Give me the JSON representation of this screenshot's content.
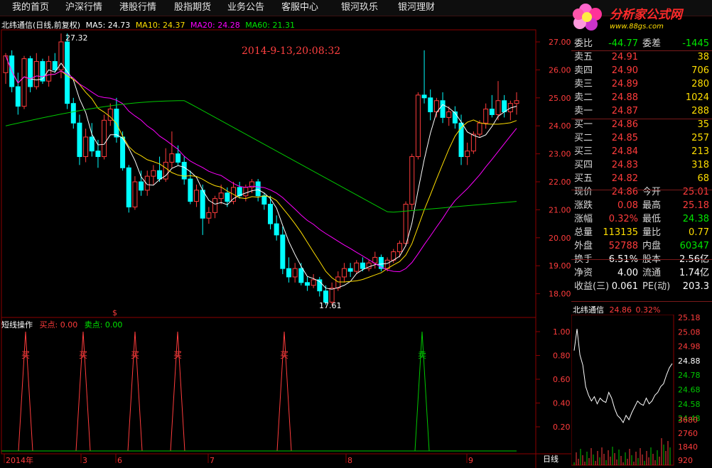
{
  "menu": [
    {
      "label": "我的首页"
    },
    {
      "label": "沪深行情"
    },
    {
      "label": "港股行情"
    },
    {
      "label": "股指期货"
    },
    {
      "label": "业务公告"
    },
    {
      "label": "客服中心"
    },
    {
      "label": "银河玖乐"
    },
    {
      "label": "银河理财"
    }
  ],
  "logo": {
    "text": "分析家公式网",
    "url": "www.88gs.com",
    "icon": "flower-logo-icon"
  },
  "header": {
    "title": "北纬通信(日线,前复权)",
    "ma5": "MA5: 24.73",
    "ma10": "MA10: 24.37",
    "ma20": "MA20: 24.28",
    "ma60": "MA60: 21.31"
  },
  "timestamp": "2014-9-13,20:08:32",
  "annotations": {
    "high": "27.32",
    "low": "17.61",
    "dollar": "$"
  },
  "price_axis": [
    "27.00",
    "26.00",
    "25.00",
    "24.00",
    "23.00",
    "22.00",
    "21.00",
    "20.00",
    "19.00",
    "18.00"
  ],
  "sub_header": {
    "name": "短线操作",
    "buy": "买点: 0.00",
    "sell": "卖点: 0.00"
  },
  "sub_axis": [
    "1.00",
    "0.80",
    "0.60",
    "0.40",
    "0.20"
  ],
  "signals": {
    "buy": "买",
    "sell": "卖"
  },
  "date_axis": [
    "2014年",
    "3",
    "6",
    "7",
    "8",
    "9"
  ],
  "bottom_tab": "日线",
  "quote": {
    "ratio_label": "委比",
    "ratio": "-44.77",
    "diff_label": "委差",
    "diff": "-1445",
    "asks": [
      {
        "label": "卖五",
        "price": "24.91",
        "vol": "38"
      },
      {
        "label": "卖四",
        "price": "24.90",
        "vol": "706"
      },
      {
        "label": "卖三",
        "price": "24.89",
        "vol": "280"
      },
      {
        "label": "卖二",
        "price": "24.88",
        "vol": "1024"
      },
      {
        "label": "卖一",
        "price": "24.87",
        "vol": "288"
      }
    ],
    "bids": [
      {
        "label": "买一",
        "price": "24.86",
        "vol": "35"
      },
      {
        "label": "买二",
        "price": "24.85",
        "vol": "257"
      },
      {
        "label": "买三",
        "price": "24.84",
        "vol": "213"
      },
      {
        "label": "买四",
        "price": "24.83",
        "vol": "318"
      },
      {
        "label": "买五",
        "price": "24.82",
        "vol": "68"
      }
    ],
    "stats": [
      {
        "l1": "现价",
        "v1": "24.86",
        "c1": "red",
        "l2": "今开",
        "v2": "25.01",
        "c2": "red"
      },
      {
        "l1": "涨跌",
        "v1": "0.08",
        "c1": "red",
        "l2": "最高",
        "v2": "25.18",
        "c2": "red"
      },
      {
        "l1": "涨幅",
        "v1": "0.32%",
        "c1": "red",
        "l2": "最低",
        "v2": "24.38",
        "c2": "green"
      },
      {
        "l1": "总量",
        "v1": "113135",
        "c1": "yellow",
        "l2": "量比",
        "v2": "0.77",
        "c2": "yellow"
      },
      {
        "l1": "外盘",
        "v1": "52788",
        "c1": "red",
        "l2": "内盘",
        "v2": "60347",
        "c2": "green"
      }
    ],
    "finance": [
      {
        "l1": "换手",
        "v1": "6.51%",
        "l2": "股本",
        "v2": "2.56亿"
      },
      {
        "l1": "净资",
        "v1": "4.00",
        "l2": "流通",
        "v2": "1.74亿"
      },
      {
        "l1": "收益(三)",
        "v1": "0.061",
        "l2": "PE(动)",
        "v2": "203.3"
      }
    ]
  },
  "mini_chart": {
    "name": "北纬通信",
    "price": "24.86",
    "pct": "0.32%",
    "price_axis": [
      "25.18",
      "25.08",
      "24.98",
      "24.88",
      "24.78",
      "24.68",
      "24.58",
      "24.48"
    ],
    "vol_axis": [
      "3680",
      "2760",
      "1840",
      "920"
    ]
  },
  "colors": {
    "up": "#ff3c3c",
    "down": "#00ffff",
    "ma5": "#ffffff",
    "ma10": "#ffde00",
    "ma20": "#ff00ff",
    "ma60": "#00c800",
    "grid": "#8b0000"
  }
}
